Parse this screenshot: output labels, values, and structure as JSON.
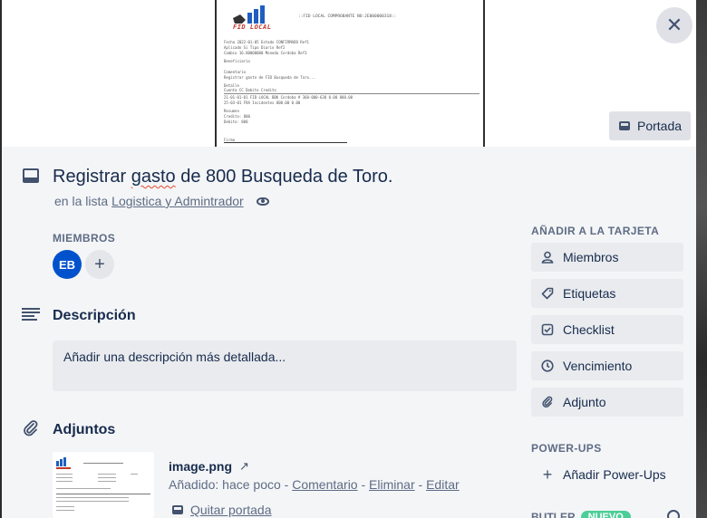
{
  "cover": {
    "button_label": "Portada",
    "document": {
      "logo_text": "FID LOCAL",
      "title": "::FID LOCAL COMPROBANTE NO:JE000000318::",
      "rows": [
        "Fecha          2022-01-05          Estado     CONFIRMADO          Ref1",
        "Aplicado       Si                  Tipo       Diario              Ref2",
        "Cambio         16.80000000         Moneda     Cordoba             Ref3",
        "Beneficiario",
        "Comentario",
        "Registrar gasto de FID Busqueda de Toro...",
        "Detalle",
        "Cuenta                             CC                   Debito       Credito",
        "21-01-01-01 FID LOCAL BBK Cordoba # 360-000-638         0.00         800.00",
        "25-03-01 FRA  Incidentes                                800.00         0.00",
        "Resumen",
        "Credito:    800",
        "Debito:     800",
        "Firma"
      ]
    }
  },
  "card": {
    "title_pre": "Registrar ",
    "title_misspelled": "gasto",
    "title_post": " de 800 Busqueda de Toro.",
    "list_prefix": "en la lista",
    "list_name": "Logistica y Admintrador"
  },
  "members": {
    "label": "MIEMBROS",
    "avatar_initials": "EB",
    "add_symbol": "+"
  },
  "description": {
    "heading": "Descripción",
    "placeholder": "Añadir una descripción más detallada..."
  },
  "attachments": {
    "heading": "Adjuntos",
    "file_name": "image.png",
    "added_prefix": "Añadido: hace poco - ",
    "comment_link": "Comentario",
    "sep": " - ",
    "delete_link": "Eliminar",
    "edit_link": "Editar",
    "remove_cover_link": "Quitar portada"
  },
  "sidebar": {
    "add_label": "AÑADIR A LA TARJETA",
    "buttons": [
      {
        "label": "Miembros",
        "icon": "person-icon"
      },
      {
        "label": "Etiquetas",
        "icon": "tag-icon"
      },
      {
        "label": "Checklist",
        "icon": "checkbox-icon"
      },
      {
        "label": "Vencimiento",
        "icon": "clock-icon"
      },
      {
        "label": "Adjunto",
        "icon": "paperclip-icon"
      }
    ],
    "powerups_label": "POWER-UPS",
    "add_powerups": "Añadir Power-Ups",
    "butler_label": "BUTLER",
    "butler_badge": "NUEVO"
  },
  "colors": {
    "avatar": "#0052cc",
    "modal_bg": "#f4f5f7",
    "button_bg": "#e9ebee",
    "badge": "#4bce97",
    "spell_underline": "#e5492b"
  }
}
